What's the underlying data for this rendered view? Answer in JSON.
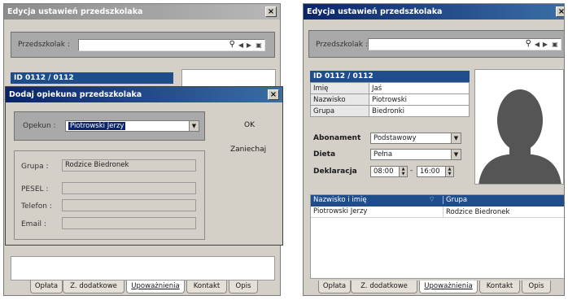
{
  "left_window": {
    "title": "Edycja ustawień przedszkolaka",
    "close_label": "×",
    "search_label": "Przedszkolak :",
    "search_value": "",
    "id_label": "ID 0112 / 0112",
    "tabs": [
      "Opłata",
      "Z. dodatkowe",
      "Upoważnienia",
      "Kontakt",
      "Opis"
    ],
    "active_tab": 2
  },
  "dialog": {
    "title": "Dodaj opiekuna przedszkolaka",
    "close_label": "×",
    "guardian_label": "Opekun :",
    "guardian_value": "Piotrowski Jerzy",
    "ok_label": "OK",
    "cancel_label": "Zaniechaj",
    "fields": [
      {
        "label": "Grupa :",
        "value": "Rodzice Biedronek"
      },
      {
        "label": "PESEL :",
        "value": ""
      },
      {
        "label": "Telefon :",
        "value": ""
      },
      {
        "label": "Email :",
        "value": ""
      }
    ]
  },
  "right_window": {
    "title": "Edycja ustawień przedszkolaka",
    "close_label": "×",
    "search_label": "Przedszkolak :",
    "search_value": "",
    "id_label": "ID 0112 / 0112",
    "info": [
      {
        "label": "Imię",
        "value": "Jaś"
      },
      {
        "label": "Nazwisko",
        "value": "Piotrowski"
      },
      {
        "label": "Grupa",
        "value": "Biedronki"
      }
    ],
    "abonament_label": "Abonament",
    "abonament_value": "Podstawowy",
    "dieta_label": "Dieta",
    "dieta_value": "Pełna",
    "deklaracja_label": "Deklaracja",
    "time_from": "08:00",
    "time_sep": "-",
    "time_to": "16:00",
    "table_headers": [
      "Nazwisko i imię",
      "Grupa"
    ],
    "table_rows": [
      {
        "name": "Piotrowski Jerzy",
        "group": "Rodzice Biedronek"
      }
    ],
    "tabs": [
      "Opłata",
      "Z. dodatkowe",
      "Upoważnienia",
      "Kontakt",
      "Opis"
    ],
    "active_tab": 2
  }
}
